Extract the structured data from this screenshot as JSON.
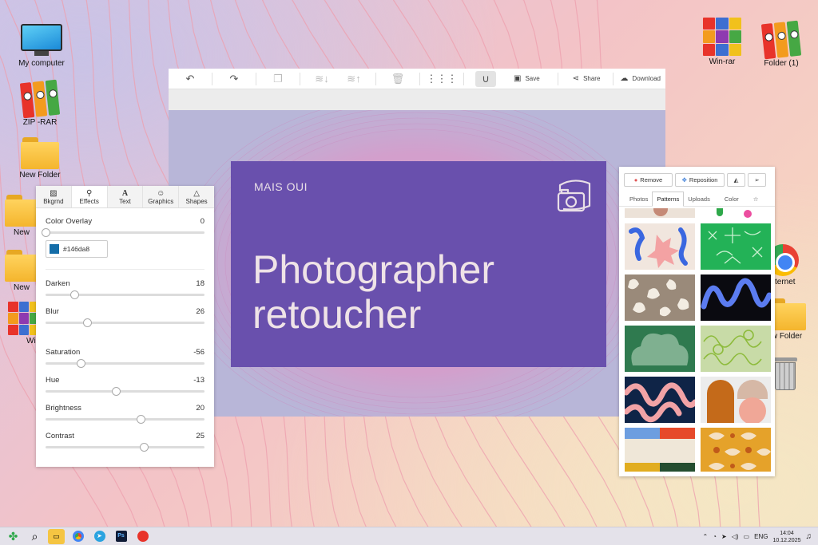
{
  "desktop": {
    "icons": {
      "my_computer": "My computer",
      "zip_rar": "ZIP -RAR",
      "new_folder": "New Folder",
      "new_a": "New",
      "new_b": "New",
      "wi": "Wi",
      "winrar": "Win-rar",
      "folder_1": "Folder (1)",
      "internet": "nternet",
      "w_folder": "w Folder"
    }
  },
  "editor": {
    "toolbar": {
      "save": "Save",
      "share": "Share",
      "download": "Download"
    },
    "card": {
      "brand": "MAIS OUI",
      "headline_line1": "Photographer",
      "headline_line2": "retoucher",
      "background": "#6950ad"
    }
  },
  "effects_panel": {
    "tabs": [
      "Bkgrnd",
      "Effects",
      "Text",
      "Graphics",
      "Shapes"
    ],
    "active_tab": "Effects",
    "color_overlay": {
      "label": "Color Overlay",
      "value": "0",
      "hex": "#146da8",
      "level": 0
    },
    "sliders": [
      {
        "label": "Darken",
        "value": "18",
        "level": 0.18
      },
      {
        "label": "Blur",
        "value": "26",
        "level": 0.26
      },
      {
        "label": "Saturation",
        "value": "-56",
        "level": 0.22
      },
      {
        "label": "Hue",
        "value": "-13",
        "level": 0.44
      },
      {
        "label": "Brightness",
        "value": "20",
        "level": 0.6
      },
      {
        "label": "Contrast",
        "value": "25",
        "level": 0.62
      }
    ]
  },
  "patterns_panel": {
    "remove": "Remove",
    "reposition": "Reposition",
    "tabs": [
      "Photos",
      "Patterns",
      "Uploads",
      "Color"
    ],
    "active_tab": "Patterns"
  },
  "taskbar": {
    "lang": "ENG",
    "time": "14:04",
    "date": "10.12.2025"
  }
}
